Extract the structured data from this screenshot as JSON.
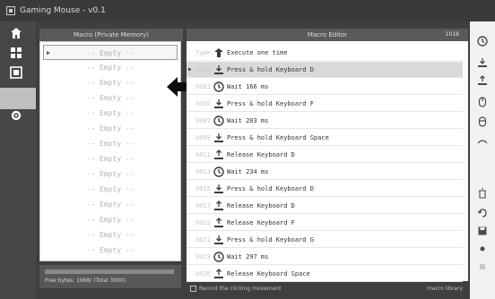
{
  "window": {
    "title": "Gaming Mouse - v0.1"
  },
  "nav": {
    "icons": [
      "home-icon",
      "grid-icon",
      "monitor-icon",
      "selected-slot",
      "gear-icon"
    ]
  },
  "list_panel": {
    "header": "Macro (Private Memory)",
    "items": [
      "-- Empty --",
      "-- Empty --",
      "-- Empty --",
      "-- Empty --",
      "-- Empty --",
      "-- Empty --",
      "-- Empty --",
      "-- Empty --",
      "-- Empty --",
      "-- Empty --",
      "-- Empty --",
      "-- Empty --",
      "-- Empty --",
      "-- Empty --"
    ],
    "status": "Free bytes: 1968/ (Total 3000)"
  },
  "editor": {
    "title": "Macro Editor",
    "count": "1018",
    "rows": [
      {
        "num": "Type",
        "icon": "mouse-icon",
        "text": "Execute one time"
      },
      {
        "num": "0001",
        "icon": "key-press-icon",
        "text": "Press & hold Keyboard  D"
      },
      {
        "num": "0003",
        "icon": "clock-icon",
        "text": "Wait 166 ms"
      },
      {
        "num": "0005",
        "icon": "key-press-icon",
        "text": "Press & hold Keyboard  F"
      },
      {
        "num": "0007",
        "icon": "clock-icon",
        "text": "Wait 203 ms"
      },
      {
        "num": "0009",
        "icon": "key-press-icon",
        "text": "Press & hold Keyboard  Space"
      },
      {
        "num": "0011",
        "icon": "key-release-icon",
        "text": "Release Keyboard  D"
      },
      {
        "num": "0013",
        "icon": "clock-icon",
        "text": "Wait 234 ms"
      },
      {
        "num": "0015",
        "icon": "key-press-icon",
        "text": "Press & hold Keyboard  D"
      },
      {
        "num": "0017",
        "icon": "key-release-icon",
        "text": "Release Keyboard  D"
      },
      {
        "num": "0019",
        "icon": "key-release-icon",
        "text": "Release Keyboard  F"
      },
      {
        "num": "0021",
        "icon": "key-press-icon",
        "text": "Press & hold Keyboard  G"
      },
      {
        "num": "0023",
        "icon": "clock-icon",
        "text": "Wait 297 ms"
      },
      {
        "num": "0026",
        "icon": "key-release-icon",
        "text": "Release Keyboard  Space"
      }
    ],
    "footer_checkbox": "Record the clicking movement",
    "footer_library": "macro library"
  },
  "toolbar": {
    "icons": [
      "clock-icon",
      "key-press-icon",
      "key-release-icon",
      "mouse-press-icon",
      "mouse-release-icon",
      "scroll-icon",
      "delete-icon",
      "undo-icon",
      "save-icon",
      "dot-icon",
      "more-icon"
    ]
  },
  "colors": {
    "titlebar": "#3a3a3a",
    "sidebar": "#474747",
    "panel": "#ffffff",
    "selected_row": "#d9d9d9"
  }
}
